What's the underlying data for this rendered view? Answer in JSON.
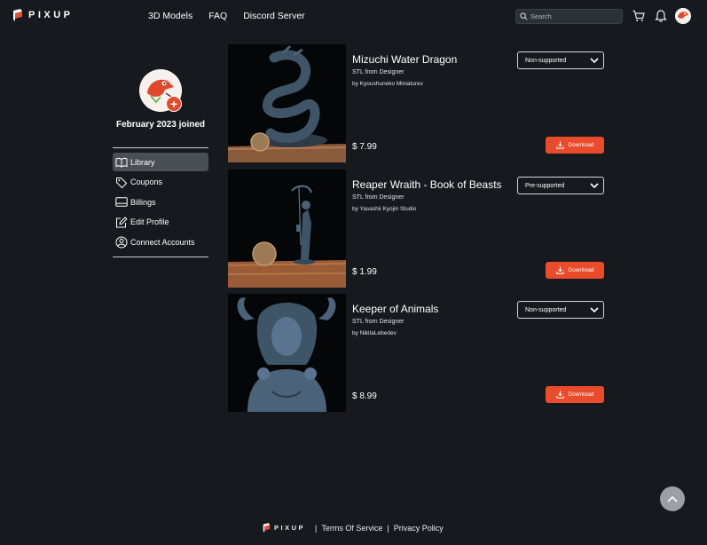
{
  "brand": {
    "name": "PIXUP",
    "accent": "#e94b2b"
  },
  "nav": {
    "items": [
      "3D Models",
      "FAQ",
      "Discord Server"
    ]
  },
  "search": {
    "placeholder": "Search"
  },
  "header_icons": [
    "cart-icon",
    "bell-icon"
  ],
  "profile": {
    "joined": "February 2023 joined",
    "add_symbol": "+"
  },
  "sidebar": {
    "items": [
      {
        "label": "Library",
        "icon": "book-icon",
        "active": true
      },
      {
        "label": "Coupons",
        "icon": "tag-icon",
        "active": false
      },
      {
        "label": "Billings",
        "icon": "card-icon",
        "active": false
      },
      {
        "label": "Edit Profile",
        "icon": "edit-icon",
        "active": false
      },
      {
        "label": "Connect Accounts",
        "icon": "user-circle-icon",
        "active": false
      }
    ]
  },
  "products": [
    {
      "title": "Mizuchi Water Dragon",
      "source": "STL from Designer",
      "by": "by Kyoushuneko Miniatures",
      "price": "$ 7.99",
      "support": "Non-supported",
      "download": "Download"
    },
    {
      "title": "Reaper Wraith - Book of Beasts",
      "source": "STL from Designer",
      "by": "by Yasashii Kyojin Studio",
      "price": "$ 1.99",
      "support": "Pre-supported",
      "download": "Download"
    },
    {
      "title": "Keeper of Animals",
      "source": "STL from Designer",
      "by": "by NikitaLebedev",
      "price": "$ 8.99",
      "support": "Non-supported",
      "download": "Download"
    }
  ],
  "footer": {
    "logo": "PIXUP",
    "separator": "|",
    "terms": "Terms Of Service",
    "privacy": "Privacy Policy"
  }
}
